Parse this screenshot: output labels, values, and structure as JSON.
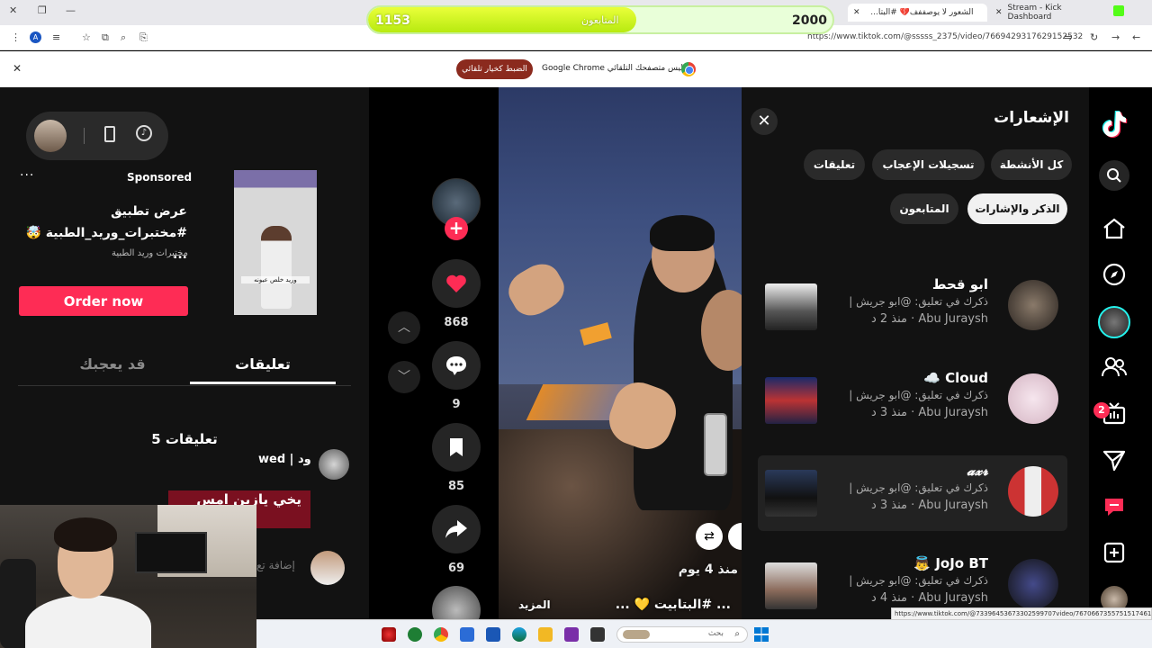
{
  "browser": {
    "tabs": [
      {
        "label": "Stream - Kick Dashboard"
      },
      {
        "label": "الشعور لا يوصففف💔 #البتا..."
      }
    ],
    "url": "https://www.tiktok.com/@sssss_2375/video/7669429317629152532",
    "infobar_message": "Google Chrome ليس متصفحك التلقائي",
    "infobar_button": "الضبط كخيار تلقائي",
    "status_url": "https://www.tiktok.com/@73396453673302599707video/7670667355751517461"
  },
  "followers_overlay": {
    "current": "1153",
    "goal": "2000",
    "label": "المتابعون",
    "progress": 0.577
  },
  "ad": {
    "sponsored_label": "Sponsored",
    "title_line1": "عرض تطبيق",
    "title_line2": "#مختبرات_وريد_الطبية 🤯 ...",
    "subtitle": "مختبرات وريد الطبية",
    "thumb_caption": "وريد خلص عيونه",
    "cta": "Order now",
    "more": "···"
  },
  "left_tabs": {
    "comments": "تعليقات",
    "you_may_like": "قد يعجبك"
  },
  "comments": {
    "count_label": "5 تعليقات",
    "items": [
      {
        "name": "wed | ود",
        "image_text": "يخي يازين امس"
      },
      {
        "placeholder": "إضافة تع"
      }
    ]
  },
  "actions": {
    "likes": "868",
    "comments": "9",
    "saves": "85",
    "shares": "69"
  },
  "video": {
    "date": "منذ 4 يوم",
    "caption": "... #البتابيت 💛 ...",
    "more": "المزيد"
  },
  "notifications": {
    "title": "الإشعارات",
    "chips": {
      "all": "كل الأنشطة",
      "likes": "تسجيلات الإعجاب",
      "comments": "تعليقات",
      "mentions": "الذكر والإشارات",
      "followers": "المتابعون"
    },
    "items": [
      {
        "name": "ابو قحط",
        "line2": "ذكرك في تعليق: @ابو جريش |",
        "line3": "Abu Juraysh · منذ 2 د"
      },
      {
        "name": "Cloud ☁️",
        "line2": "ذكرك في تعليق: @ابو جريش |",
        "line3": "Abu Juraysh · منذ 3 د"
      },
      {
        "name": "𝓪𝔁𝓻",
        "line2": "ذكرك في تعليق: @ابو جريش |",
        "line3": "Abu Juraysh · منذ 3 د"
      },
      {
        "name": "JoJo BT 👼",
        "line2": "ذكرك في تعليق: @ابو جريش |",
        "line3": "Abu Juraysh · منذ 4 د"
      }
    ]
  },
  "rnav": {
    "inbox_badge": "2"
  },
  "taskbar": {
    "search_placeholder": "بحث"
  }
}
